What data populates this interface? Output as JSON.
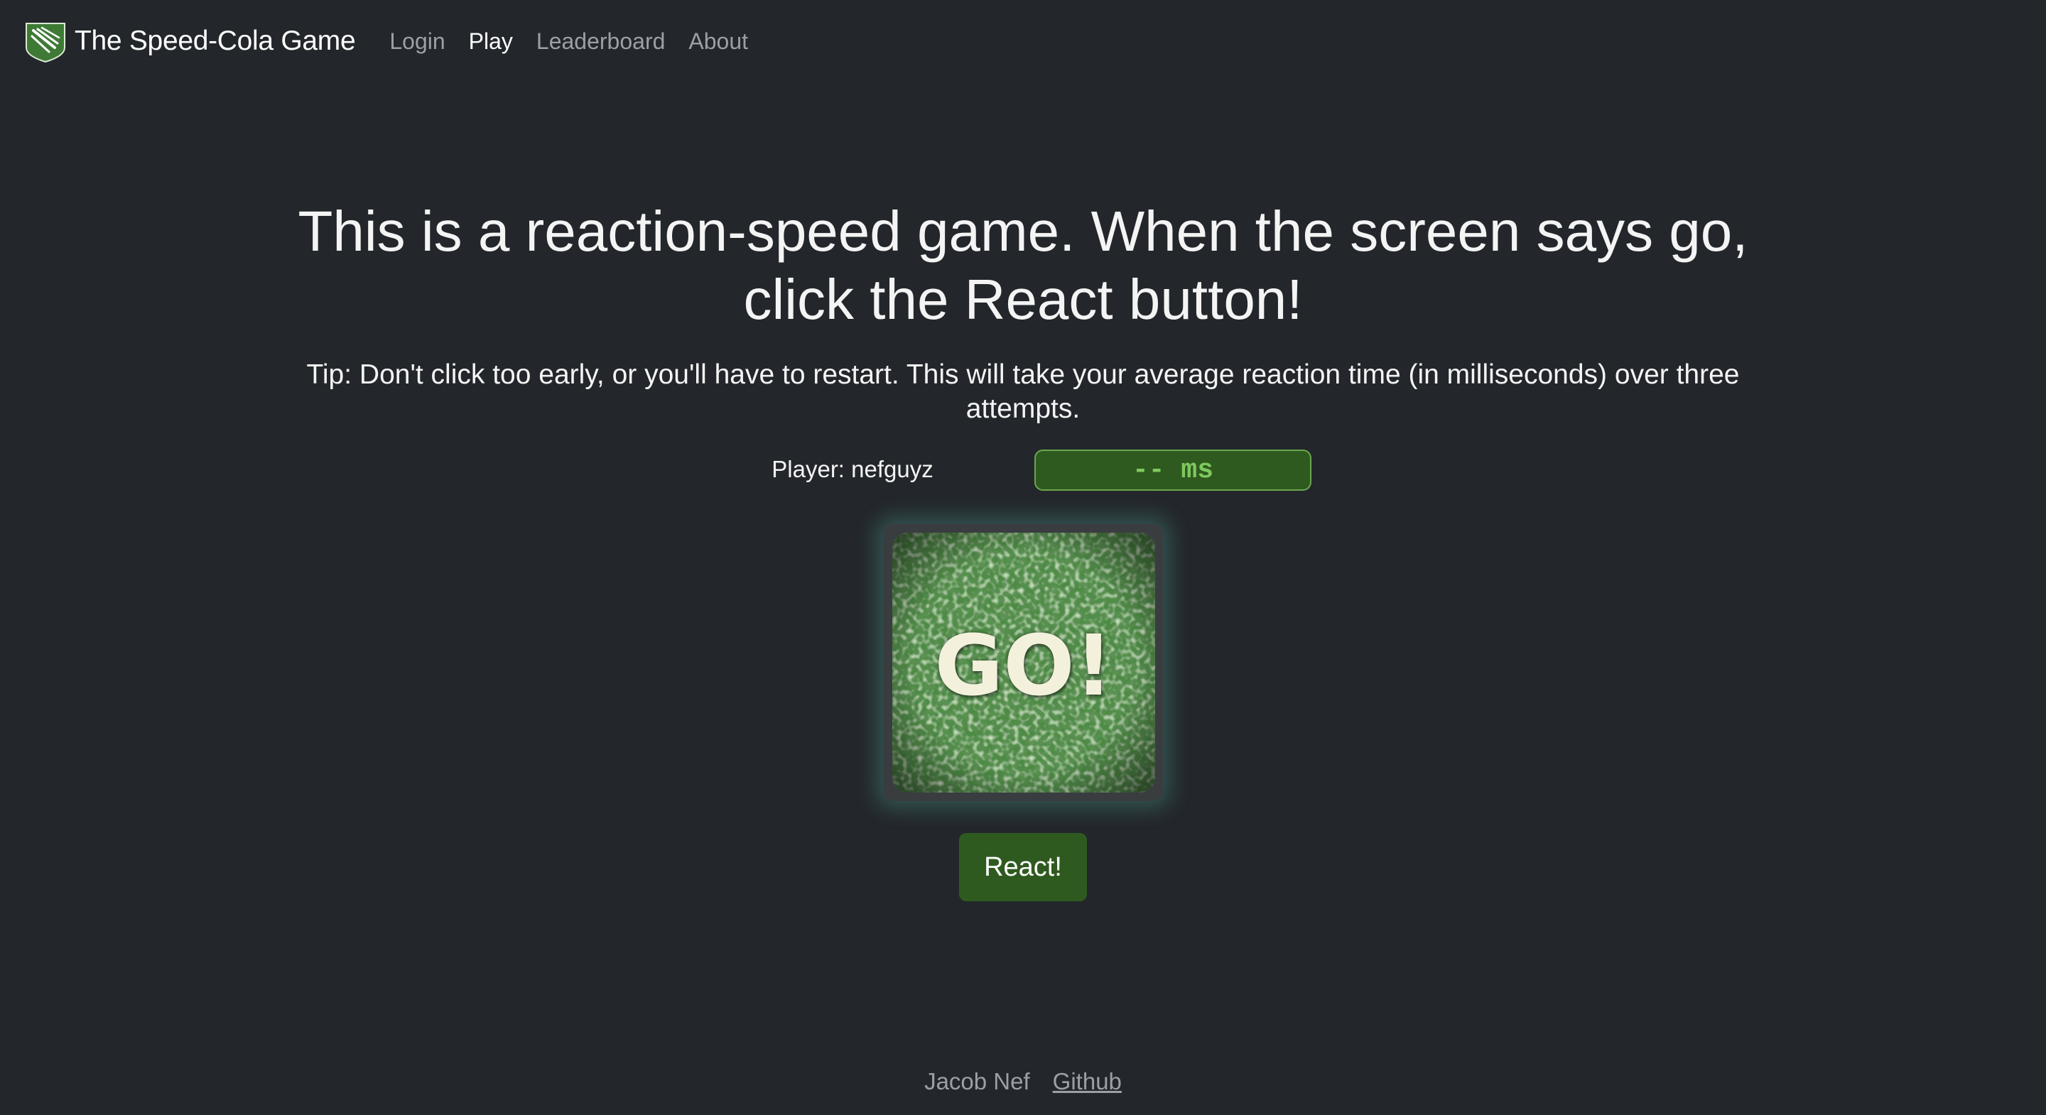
{
  "navbar": {
    "brand": "The Speed-Cola Game",
    "brand_icon": "speed-cola-shield-icon",
    "links": [
      {
        "label": "Login",
        "active": false
      },
      {
        "label": "Play",
        "active": true
      },
      {
        "label": "Leaderboard",
        "active": false
      },
      {
        "label": "About",
        "active": false
      }
    ]
  },
  "main": {
    "heading": "This is a reaction-speed game. When the screen says go, click the React button!",
    "tip": "Tip: Don't click too early, or you'll have to restart. This will take your average reaction time (in milliseconds) over three attempts.",
    "player_label": "Player: nefguyz",
    "timer_display": "-- ms",
    "screen_text": "GO!",
    "react_button": "React!"
  },
  "footer": {
    "author": "Jacob Nef",
    "link": "Github"
  },
  "colors": {
    "background": "#23272b",
    "accent_green": "#2f5a1f",
    "timer_text": "#7ec85e",
    "muted_text": "#9aa0a6"
  }
}
